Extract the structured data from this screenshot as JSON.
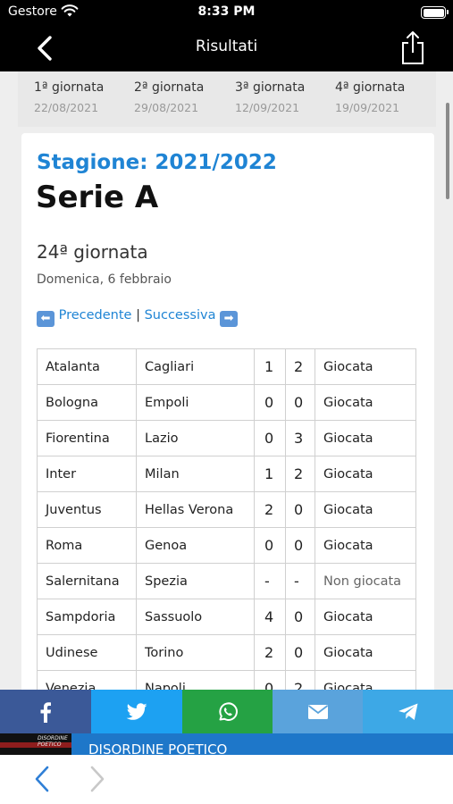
{
  "status_bar": {
    "carrier": "Gestore",
    "time": "8:33 PM"
  },
  "nav": {
    "title": "Risultati",
    "back_icon": "chevron-left-icon",
    "share_icon": "share-icon"
  },
  "rounds": [
    {
      "name": "1ª giornata",
      "date": "22/08/2021"
    },
    {
      "name": "2ª giornata",
      "date": "29/08/2021"
    },
    {
      "name": "3ª giornata",
      "date": "12/09/2021"
    },
    {
      "name": "4ª giornata",
      "date": "19/09/2021"
    }
  ],
  "card": {
    "season": "Stagione: 2021/2022",
    "league": "Serie A",
    "matchday": "24ª giornata",
    "date": "Domenica, 6 febbraio",
    "pager": {
      "prev_icon": "arrow-left-icon",
      "prev": "Precedente",
      "separator": "|",
      "next": "Successiva",
      "next_icon": "arrow-right-icon"
    }
  },
  "matches": [
    {
      "home": "Atalanta",
      "away": "Cagliari",
      "s1": "1",
      "s2": "2",
      "status": "Giocata"
    },
    {
      "home": "Bologna",
      "away": "Empoli",
      "s1": "0",
      "s2": "0",
      "status": "Giocata"
    },
    {
      "home": "Fiorentina",
      "away": "Lazio",
      "s1": "0",
      "s2": "3",
      "status": "Giocata"
    },
    {
      "home": "Inter",
      "away": "Milan",
      "s1": "1",
      "s2": "2",
      "status": "Giocata"
    },
    {
      "home": "Juventus",
      "away": "Hellas Verona",
      "s1": "2",
      "s2": "0",
      "status": "Giocata"
    },
    {
      "home": "Roma",
      "away": "Genoa",
      "s1": "0",
      "s2": "0",
      "status": "Giocata"
    },
    {
      "home": "Salernitana",
      "away": "Spezia",
      "s1": "-",
      "s2": "-",
      "status": "Non giocata"
    },
    {
      "home": "Sampdoria",
      "away": "Sassuolo",
      "s1": "4",
      "s2": "0",
      "status": "Giocata"
    },
    {
      "home": "Udinese",
      "away": "Torino",
      "s1": "2",
      "s2": "0",
      "status": "Giocata"
    },
    {
      "home": "Venezia",
      "away": "Napoli",
      "s1": "0",
      "s2": "2",
      "status": "Giocata"
    }
  ],
  "share_bar": [
    {
      "name": "facebook",
      "icon": "facebook-icon",
      "color": "#3b5998"
    },
    {
      "name": "twitter",
      "icon": "twitter-icon",
      "color": "#1da1f2"
    },
    {
      "name": "whatsapp",
      "icon": "whatsapp-icon",
      "color": "#25a244"
    },
    {
      "name": "email",
      "icon": "mail-icon",
      "color": "#5aa3dc"
    },
    {
      "name": "telegram",
      "icon": "telegram-icon",
      "color": "#3da8e6"
    }
  ],
  "banner": {
    "text": "DISORDINE POETICO",
    "logo_text": "DISORDINE POETICO"
  },
  "bottom_nav": {
    "back_icon": "chevron-left-icon",
    "forward_icon": "chevron-right-icon"
  },
  "colors": {
    "accent": "#1f84d4",
    "nav_bg": "#000000",
    "banner_bg": "#1e77c9"
  }
}
